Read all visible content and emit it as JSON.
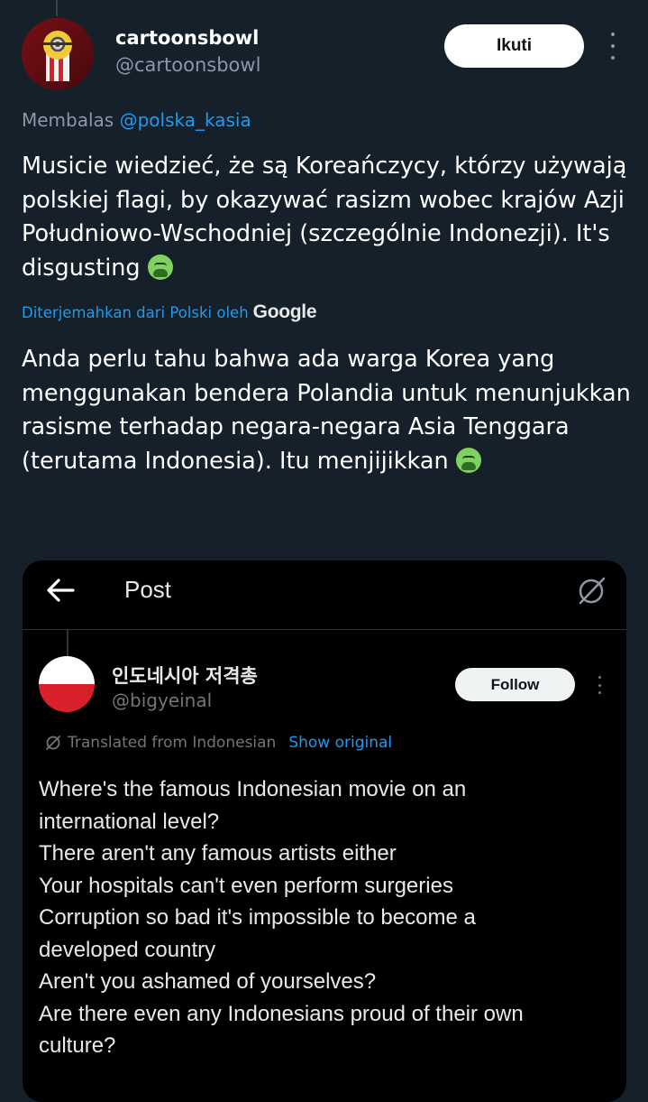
{
  "reply": {
    "author": {
      "name": "cartoonsbowl",
      "handle": "@cartoonsbowl"
    },
    "follow_label": "Ikuti",
    "replying_prefix": "Membalas",
    "replying_to": "@polska_kasia",
    "original_text": "Musicie wiedzieć, że są Koreańczycy, którzy używają polskiej flagi, by okazywać rasizm wobec krajów Azji Południowo-Wschodniej (szczególnie Indonezji). It's disgusting",
    "translated_by": "Diterjemahkan dari Polski oleh",
    "translator": "Google",
    "translated_text": "Anda perlu tahu bahwa ada warga Korea yang menggunakan bendera Polandia untuk menunjukkan rasisme terhadap negara-negara Asia Tenggara (terutama Indonesia). Itu menjijikkan",
    "emoji": "nauseated-face"
  },
  "embed": {
    "header_title": "Post",
    "author": {
      "name": "인도네시아 저격총",
      "handle": "@bigyeinal"
    },
    "follow_label": "Follow",
    "translated_from": "Translated from Indonesian",
    "show_original": "Show original",
    "body_lines": [
      "Where's the famous Indonesian movie on an",
      "international level?",
      "There aren't any famous artists either",
      "Your hospitals can't even perform surgeries",
      "Corruption so bad it's impossible to become a",
      "developed country",
      "Aren't you ashamed of yourselves?",
      "Are there even any Indonesians proud of their own",
      "culture?"
    ]
  },
  "colors": {
    "background": "#15202b",
    "accent": "#1d9bf0",
    "muted": "#8b98a5"
  }
}
